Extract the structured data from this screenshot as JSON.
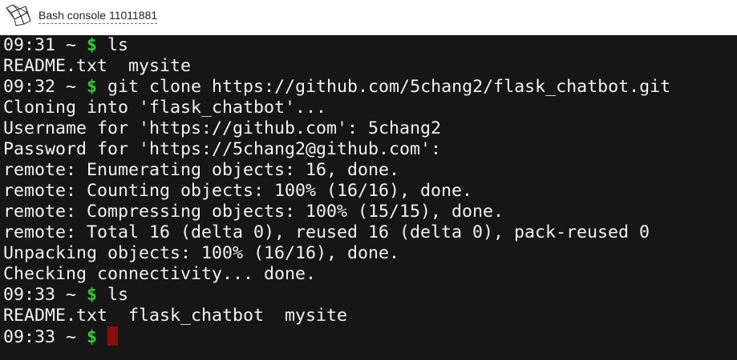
{
  "header": {
    "title": "Bash console 11011881",
    "logo_icon": "pythonanywhere-logo-icon"
  },
  "terminal": {
    "colors": {
      "background": "#161616",
      "text": "#f2f2f2",
      "prompt_dollar": "#2ecc2e",
      "cursor": "#8b0d0d"
    },
    "lines": [
      {
        "kind": "prompt",
        "time": "09:31 ~",
        "symbol": "$",
        "command": " ls"
      },
      {
        "kind": "output",
        "text": "README.txt  mysite"
      },
      {
        "kind": "prompt",
        "time": "09:32 ~",
        "symbol": "$",
        "command": " git clone https://github.com/5chang2/flask_chatbot.git"
      },
      {
        "kind": "output",
        "text": "Cloning into 'flask_chatbot'..."
      },
      {
        "kind": "output",
        "text": "Username for 'https://github.com': 5chang2"
      },
      {
        "kind": "output",
        "text": "Password for 'https://5chang2@github.com':"
      },
      {
        "kind": "output",
        "text": "remote: Enumerating objects: 16, done."
      },
      {
        "kind": "output",
        "text": "remote: Counting objects: 100% (16/16), done."
      },
      {
        "kind": "output",
        "text": "remote: Compressing objects: 100% (15/15), done."
      },
      {
        "kind": "output",
        "text": "remote: Total 16 (delta 0), reused 16 (delta 0), pack-reused 0"
      },
      {
        "kind": "output",
        "text": "Unpacking objects: 100% (16/16), done."
      },
      {
        "kind": "output",
        "text": "Checking connectivity... done."
      },
      {
        "kind": "prompt",
        "time": "09:33 ~",
        "symbol": "$",
        "command": " ls"
      },
      {
        "kind": "output",
        "text": "README.txt  flask_chatbot  mysite"
      },
      {
        "kind": "prompt",
        "time": "09:33 ~",
        "symbol": "$",
        "command": " ",
        "cursor": true
      }
    ]
  }
}
